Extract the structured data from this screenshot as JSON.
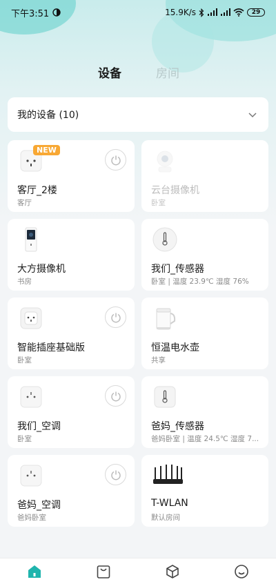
{
  "status_bar": {
    "time": "下午3:51",
    "network_speed": "15.9K/s",
    "battery": "29"
  },
  "tabs": {
    "devices": "设备",
    "rooms": "房间"
  },
  "selector": {
    "label": "我的设备 (10)"
  },
  "devices": [
    {
      "name": "客厅_2楼",
      "subtitle": "客厅",
      "icon": "smart-plug-icon",
      "badge": "NEW",
      "power_button": true,
      "offline": false
    },
    {
      "name": "云台摄像机",
      "subtitle": "卧室",
      "icon": "ptz-camera-icon",
      "power_button": false,
      "offline": true
    },
    {
      "name": "大方摄像机",
      "subtitle": "书房",
      "icon": "camera-icon",
      "power_button": false,
      "offline": false
    },
    {
      "name": "我们_传感器",
      "subtitle": "卧室 | 温度 23.9℃ 湿度 76%",
      "icon": "temperature-sensor-icon",
      "power_button": false,
      "offline": false
    },
    {
      "name": "智能插座基础版",
      "subtitle": "卧室",
      "icon": "wall-socket-icon",
      "power_button": true,
      "offline": false
    },
    {
      "name": "恒温电水壶",
      "subtitle": "共享",
      "icon": "kettle-icon",
      "power_button": false,
      "offline": false
    },
    {
      "name": "我们_空调",
      "subtitle": "卧室",
      "icon": "ac-companion-icon",
      "power_button": true,
      "offline": false
    },
    {
      "name": "爸妈_传感器",
      "subtitle": "爸妈卧室 | 温度 24.5℃ 湿度 7...",
      "icon": "temperature-sensor-square-icon",
      "power_button": false,
      "offline": false
    },
    {
      "name": "爸妈_空调",
      "subtitle": "爸妈卧室",
      "icon": "ac-companion-icon",
      "power_button": true,
      "offline": false
    },
    {
      "name": "T-WLAN",
      "subtitle": "默认房间",
      "icon": "router-icon",
      "power_button": false,
      "offline": false
    }
  ],
  "bottom_nav": [
    {
      "icon": "home-icon",
      "active": true
    },
    {
      "icon": "store-icon",
      "active": false
    },
    {
      "icon": "smart-cube-icon",
      "active": false
    },
    {
      "icon": "profile-face-icon",
      "active": false
    }
  ],
  "colors": {
    "accent": "#1fb4ad",
    "background": "#f3f5f7",
    "badge": "#f8a834"
  }
}
